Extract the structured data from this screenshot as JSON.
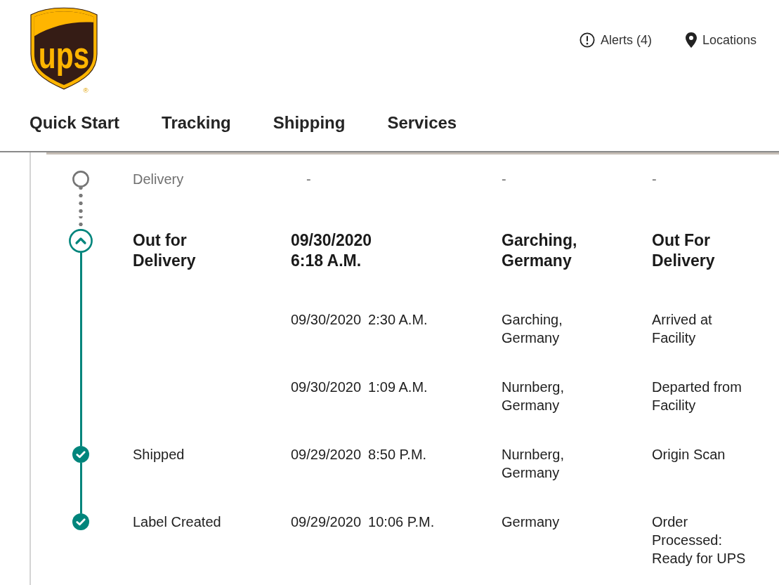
{
  "header": {
    "logo": {
      "text": "ups",
      "mark": "®"
    },
    "links": [
      {
        "kind": "alerts",
        "label": "Alerts (4)"
      },
      {
        "kind": "locations",
        "label": "Locations"
      }
    ]
  },
  "nav": [
    {
      "label": "Quick Start"
    },
    {
      "label": "Tracking"
    },
    {
      "label": "Shipping"
    },
    {
      "label": "Services"
    }
  ],
  "progress": [
    {
      "status": "Delivery",
      "kind": "pending",
      "events": [
        {
          "date": "-",
          "location": "-",
          "activity": "-"
        }
      ]
    },
    {
      "status": "Out for Delivery",
      "kind": "current",
      "expanded": true,
      "events": [
        {
          "date": "09/30/2020",
          "time": "6:18 A.M.",
          "location": "Garching, Germany",
          "activity": "Out For Delivery"
        },
        {
          "date": "09/30/2020",
          "time": "2:30 A.M.",
          "location": "Garching, Germany",
          "activity": "Arrived at Facility"
        },
        {
          "date": "09/30/2020",
          "time": "1:09 A.M.",
          "location": "Nurnberg, Germany",
          "activity": "Departed from Facility"
        }
      ]
    },
    {
      "status": "Shipped",
      "kind": "done",
      "events": [
        {
          "date": "09/29/2020",
          "time": "8:50 P.M.",
          "location": "Nurnberg, Germany",
          "activity": "Origin Scan"
        }
      ]
    },
    {
      "status": "Label Created",
      "kind": "done",
      "events": [
        {
          "date": "09/29/2020",
          "time": "10:06 P.M.",
          "location": "Germany",
          "activity": "Order Processed: Ready for UPS"
        }
      ]
    }
  ]
}
